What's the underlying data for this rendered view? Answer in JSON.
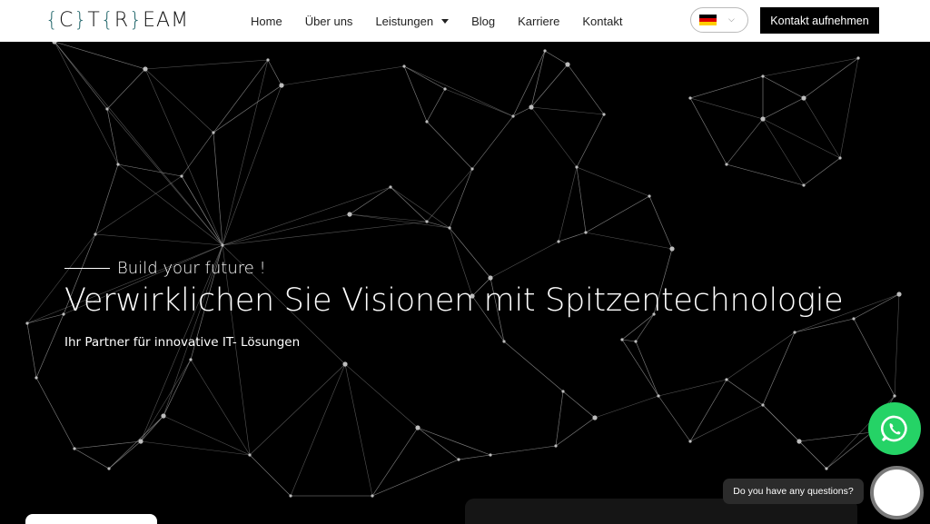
{
  "header": {
    "logo_parts": [
      "{",
      "C",
      "}",
      "T",
      "{",
      "R",
      "}",
      "EAM"
    ],
    "nav": [
      {
        "label": "Home"
      },
      {
        "label": "Über uns"
      },
      {
        "label": "Leistungen",
        "dropdown": true
      },
      {
        "label": "Blog"
      },
      {
        "label": "Karriere"
      },
      {
        "label": "Kontakt"
      }
    ],
    "language": {
      "selected": "de",
      "flag_colors": [
        "#000000",
        "#DD0000",
        "#FFCE00"
      ],
      "chevron_icon": "chevron-down-icon"
    },
    "cta_label": "Kontakt aufnehmen"
  },
  "hero": {
    "tagline": "Build your future !",
    "headline": "Verwirklichen Sie Visionen mit Spitzentechnologie",
    "subline": "Ihr Partner für innovative IT- Lösungen",
    "background": "network-graph"
  },
  "widgets": {
    "whatsapp_icon": "whatsapp-icon",
    "whatsapp_color": "#25D366",
    "chat_prompt": "Do you have any questions?"
  }
}
